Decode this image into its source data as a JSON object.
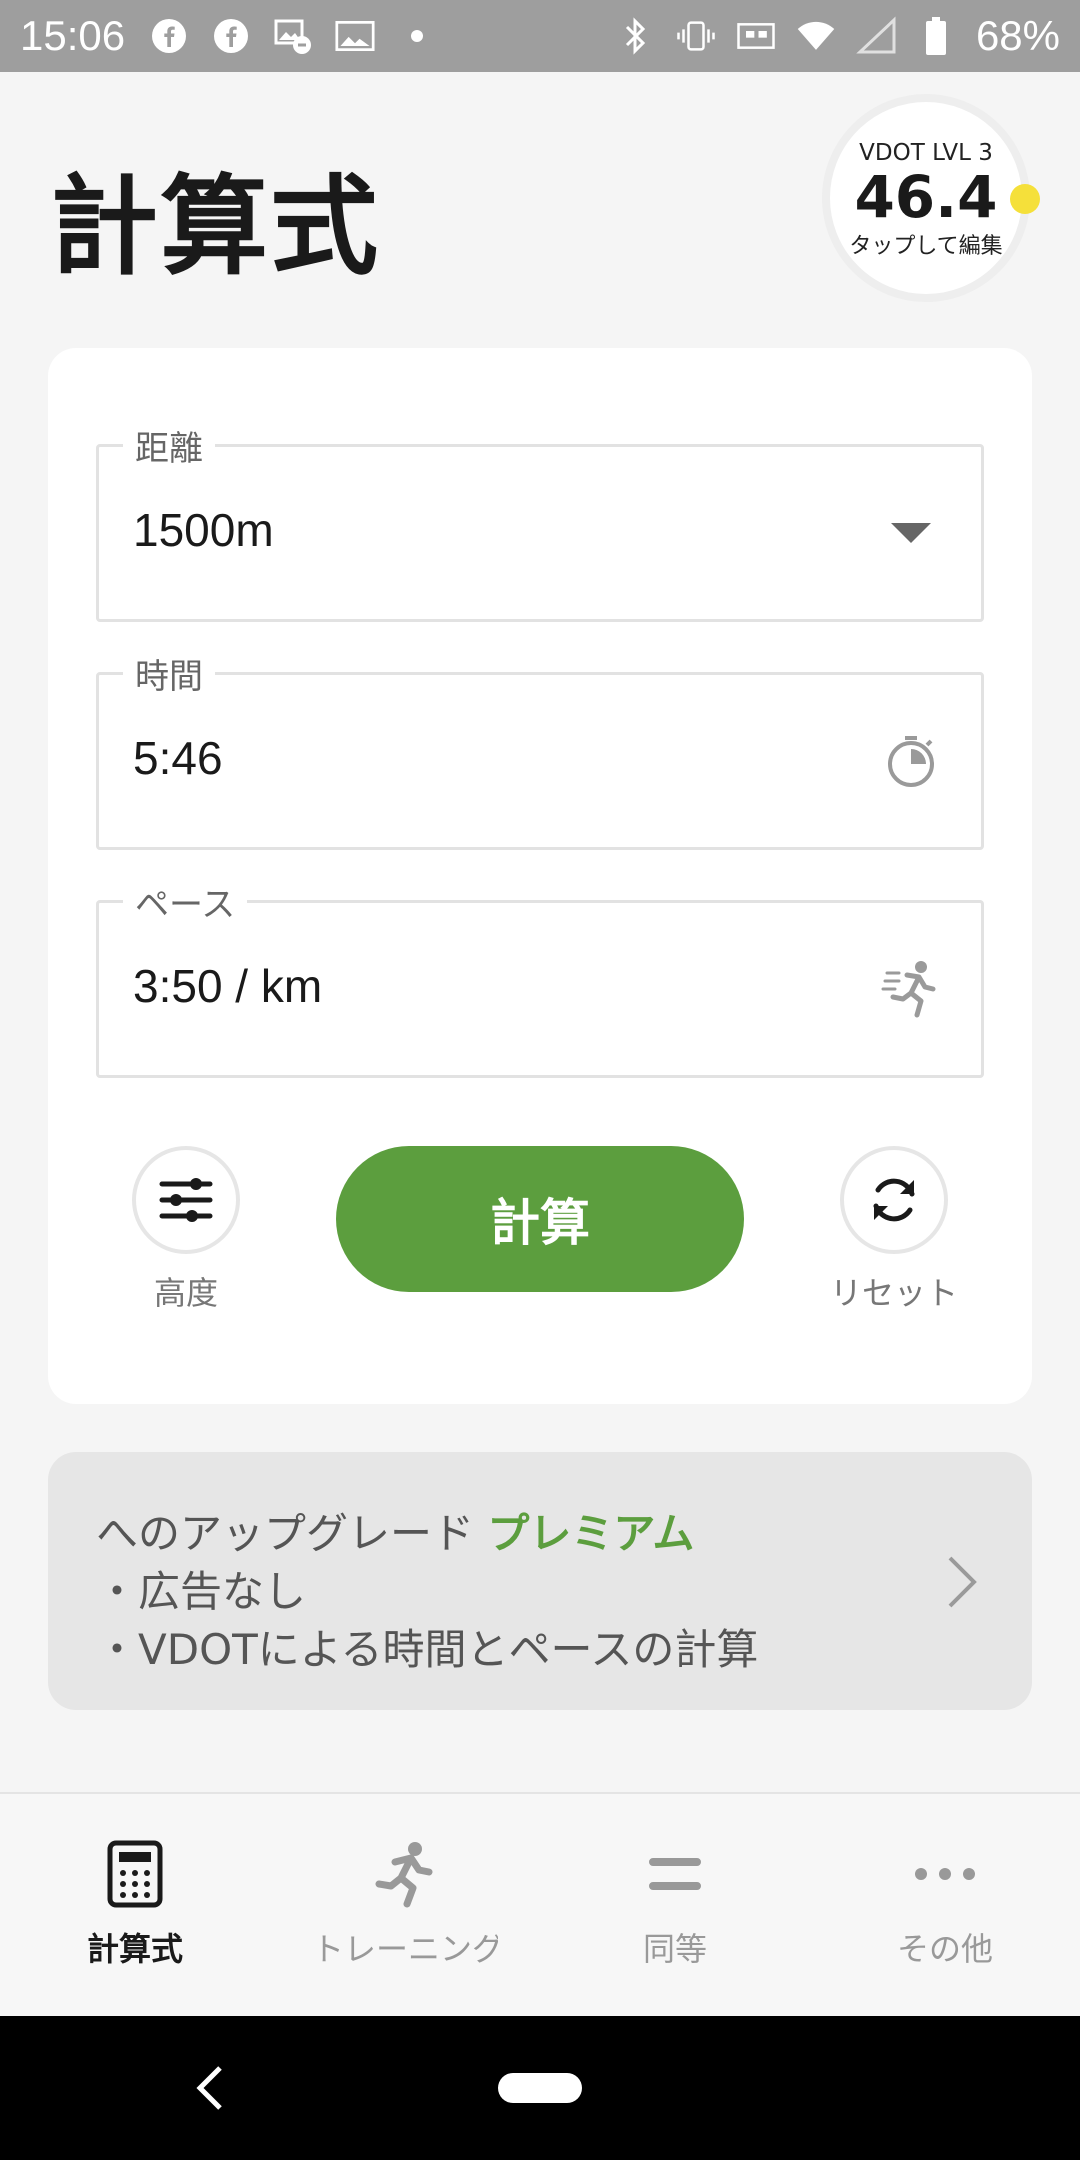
{
  "status_bar": {
    "time": "15:06",
    "battery": "68%",
    "left_icons": [
      "facebook-icon",
      "facebook-icon",
      "gallery-notification-icon",
      "image-icon",
      "dot-icon"
    ],
    "right_icons": [
      "bluetooth-icon",
      "vibrate-icon",
      "cast-icon",
      "wifi-icon",
      "signal-icon",
      "battery-icon"
    ]
  },
  "header": {
    "title": "計算式"
  },
  "vdot": {
    "level": "VDOT LVL 3",
    "value": "46.4",
    "hint": "タップして編集",
    "dot_color": "#f5e03a"
  },
  "form": {
    "distance": {
      "label": "距離",
      "value": "1500m",
      "icon": "dropdown-arrow-icon"
    },
    "time": {
      "label": "時間",
      "value": "5:46",
      "icon": "stopwatch-icon"
    },
    "pace": {
      "label": "ペース",
      "value": "3:50 / km",
      "icon": "runner-icon"
    }
  },
  "actions": {
    "advanced_label": "高度",
    "calculate_label": "計算",
    "reset_label": "リセット"
  },
  "promo": {
    "prefix": "へのアップグレード ",
    "highlight": "プレミアム",
    "bullet1": "・広告なし",
    "bullet2": "・VDOTによる時間とペースの計算"
  },
  "bottom_nav": {
    "items": [
      {
        "label": "計算式",
        "icon": "calculator-icon",
        "active": true
      },
      {
        "label": "トレーニング",
        "icon": "runner-icon",
        "active": false
      },
      {
        "label": "同等",
        "icon": "equals-icon",
        "active": false
      },
      {
        "label": "その他",
        "icon": "more-dots-icon",
        "active": false
      }
    ]
  },
  "colors": {
    "accent_green": "#5c9e3e",
    "status_bar": "#9e9e9e",
    "background": "#f5f5f5"
  }
}
